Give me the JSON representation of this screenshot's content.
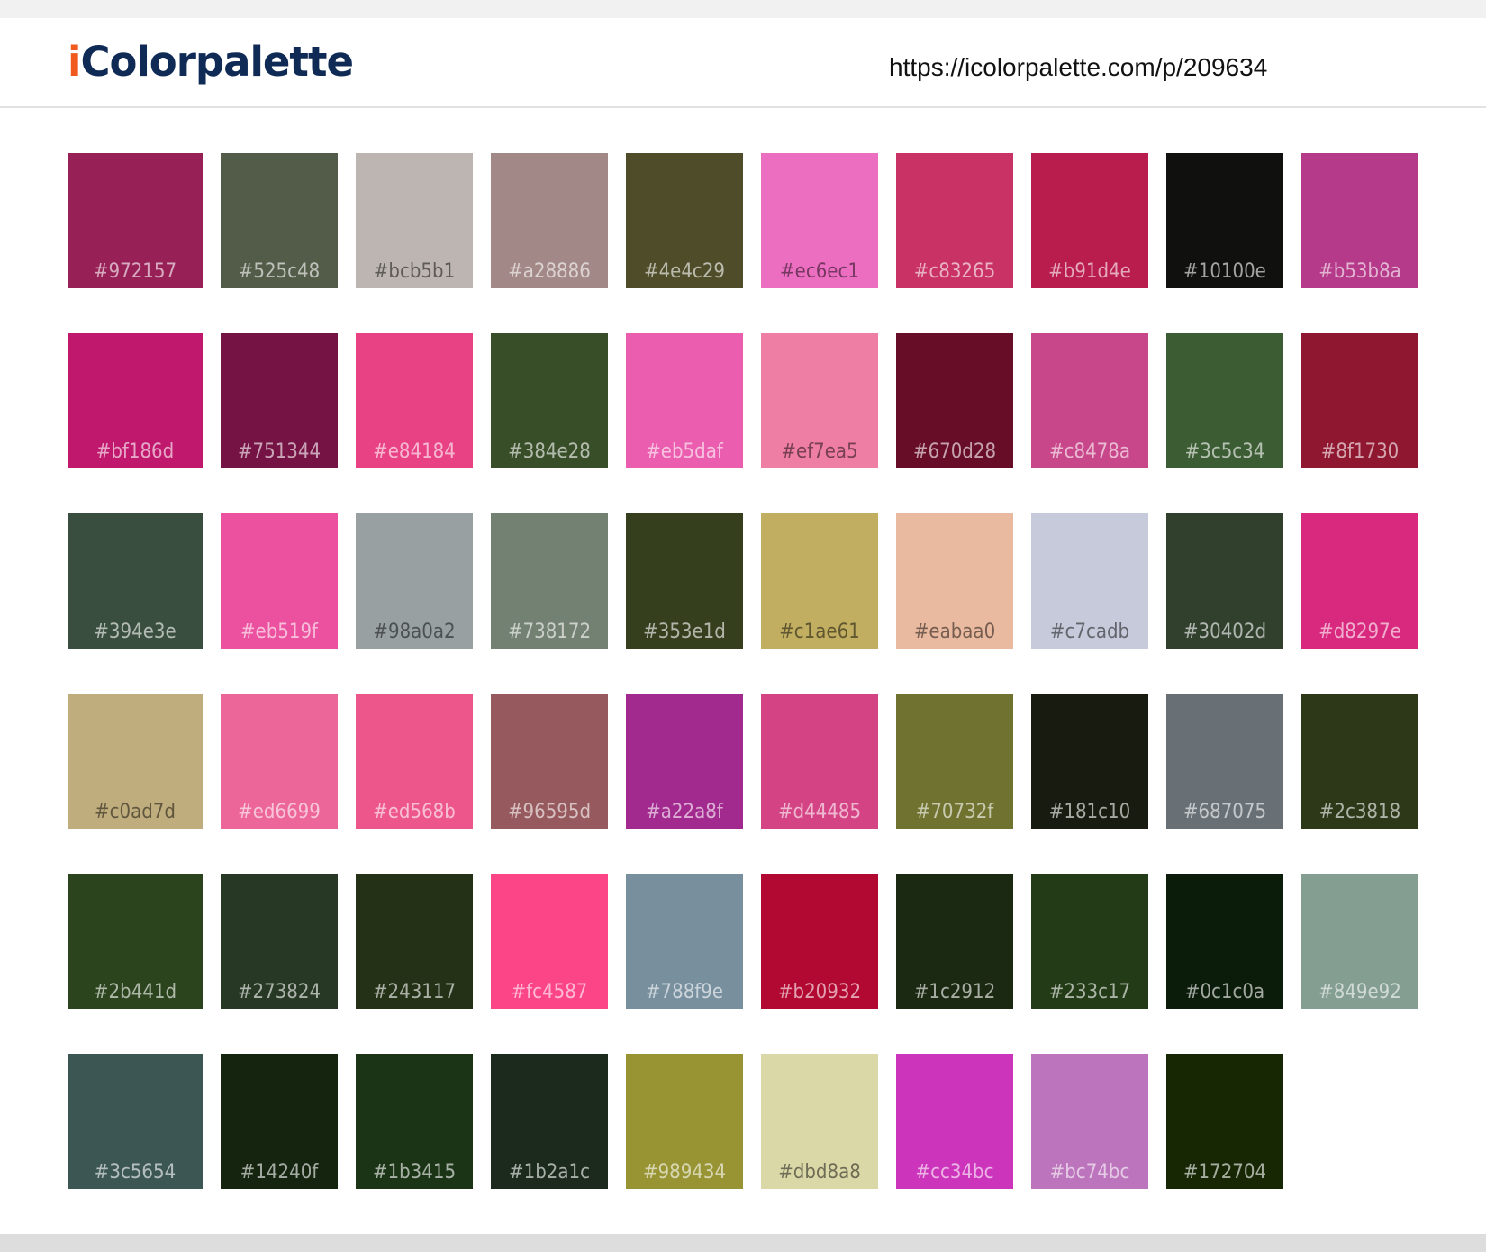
{
  "header": {
    "logo_i": "i",
    "logo_rest": "Colorpalette",
    "url": "https://icolorpalette.com/p/209634"
  },
  "swatches": [
    [
      "#972157",
      "#525c48",
      "#bcb5b1",
      "#a28886",
      "#4e4c29",
      "#ec6ec1",
      "#c83265",
      "#b91d4e",
      "#10100e",
      "#b53b8a"
    ],
    [
      "#bf186d",
      "#751344",
      "#e84184",
      "#384e28",
      "#eb5daf",
      "#ef7ea5",
      "#670d28",
      "#c8478a",
      "#3c5c34",
      "#8f1730"
    ],
    [
      "#394e3e",
      "#eb519f",
      "#98a0a2",
      "#738172",
      "#353e1d",
      "#c1ae61",
      "#eabaa0",
      "#c7cadb",
      "#30402d",
      "#d8297e"
    ],
    [
      "#c0ad7d",
      "#ed6699",
      "#ed568b",
      "#96595d",
      "#a22a8f",
      "#d44485",
      "#70732f",
      "#181c10",
      "#687075",
      "#2c3818"
    ],
    [
      "#2b441d",
      "#273824",
      "#243117",
      "#fc4587",
      "#788f9e",
      "#b20932",
      "#1c2912",
      "#233c17",
      "#0c1c0a",
      "#849e92"
    ],
    [
      "#3c5654",
      "#14240f",
      "#1b3415",
      "#1b2a1c",
      "#989434",
      "#dbd8a8",
      "#cc34bc",
      "#bc74bc",
      "#172704"
    ]
  ]
}
